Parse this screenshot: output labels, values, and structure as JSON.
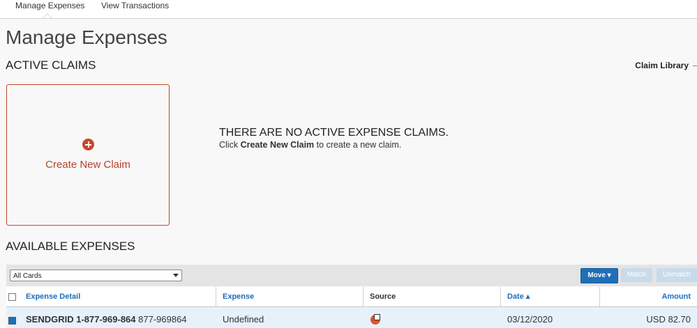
{
  "tabs": [
    "Manage Expenses",
    "View Transactions"
  ],
  "page_title": "Manage Expenses",
  "active_claims": {
    "title": "ACTIVE CLAIMS",
    "claim_library": "Claim Library",
    "new_claim_label": "Create New Claim",
    "empty_title": "THERE ARE NO ACTIVE EXPENSE CLAIMS.",
    "empty_sub_prefix": "Click",
    "empty_sub_bold": "Create New Claim",
    "empty_sub_suffix": "to create a new claim."
  },
  "available": {
    "title": "AVAILABLE EXPENSES",
    "card_filter": "All Cards",
    "buttons": {
      "move": "Move ▾",
      "match": "Match",
      "unmatch": "Unmatch"
    },
    "columns": [
      "Expense Detail",
      "Expense",
      "Source",
      "Date ▴",
      "Amount"
    ],
    "row": {
      "detail_bold": "SENDGRID 1-877-969-864",
      "detail_rest": "877-969864",
      "expense": "Undefined",
      "date": "03/12/2020",
      "amount": "USD 82.70"
    }
  },
  "colors": {
    "accent": "#c5482d",
    "primary": "#1f6fb8"
  },
  "icons": [
    "plus-circle-icon",
    "dropdown-arrow-icon",
    "sort-asc-icon",
    "source-card-icon"
  ]
}
